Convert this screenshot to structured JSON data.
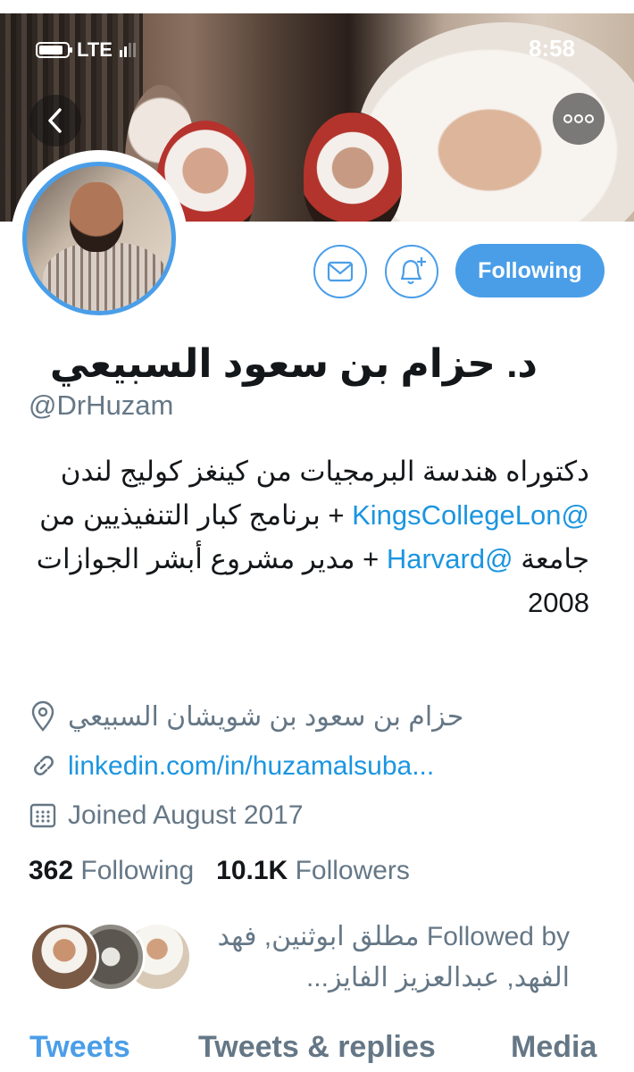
{
  "status_bar": {
    "carrier": "LTE",
    "time": "8:58",
    "battery_level": 0.85,
    "signal_bars": 2
  },
  "profile": {
    "display_name": "د. حزام بن سعود السبيعي",
    "handle": "@DrHuzam",
    "bio": {
      "part1": "دكتوراه هندسة البرمجيات من كينغز كوليج لندن ",
      "mention1": "@KingsCollegeLon",
      "part2": " + برنامج كبار التنفيذيين من جامعة ",
      "mention2": "@Harvard",
      "part3": " + مدير مشروع أبشر الجوازات 2008"
    },
    "location": "حزام بن سعود بن شويشان السبيعي",
    "website": "linkedin.com/in/huzamalsuba...",
    "joined": "Joined August 2017",
    "following_count": "362",
    "following_label": "Following",
    "followers_count": "10.1K",
    "followers_label": "Followers",
    "followed_by": "Followed by مطلق ابوثنين, فهد الفهد, عبدالعزيز الفايز..."
  },
  "actions": {
    "follow_label": "Following"
  },
  "tabs": [
    {
      "label": "Tweets",
      "active": true
    },
    {
      "label": "Tweets & replies",
      "active": false
    },
    {
      "label": "Media",
      "active": false
    }
  ],
  "colors": {
    "accent": "#4a9ee8",
    "link": "#1b95e0",
    "secondary_text": "#657786",
    "primary_text": "#14171a"
  },
  "icons": [
    "back-arrow-icon",
    "more-options-icon",
    "envelope-icon",
    "bell-plus-icon",
    "location-pin-icon",
    "link-icon",
    "calendar-icon"
  ]
}
